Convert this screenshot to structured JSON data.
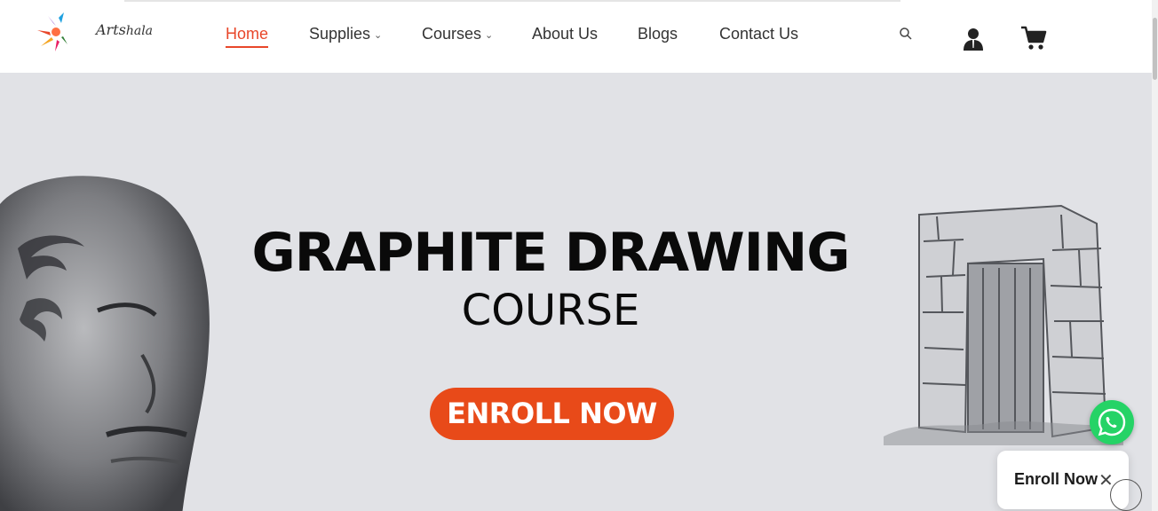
{
  "logo": {
    "text_a": "Arts",
    "text_b": "hala"
  },
  "nav": [
    {
      "label": "Home",
      "active": true
    },
    {
      "label": "Supplies",
      "dropdown": true
    },
    {
      "label": "Courses",
      "dropdown": true
    },
    {
      "label": "About Us"
    },
    {
      "label": "Blogs"
    },
    {
      "label": "Contact Us"
    }
  ],
  "icons": {
    "search": "search-icon",
    "account": "user-icon",
    "cart": "cart-icon"
  },
  "hero": {
    "title": "GRAPHITE DRAWING",
    "subtitle": "COURSE",
    "cta": "ENROLL NOW"
  },
  "popup": {
    "text": "Enroll Now",
    "close": "✕"
  },
  "colors": {
    "accent": "#e8472a",
    "cta": "#e84a19",
    "hero_bg": "#e1e2e6",
    "whatsapp": "#25d366"
  }
}
